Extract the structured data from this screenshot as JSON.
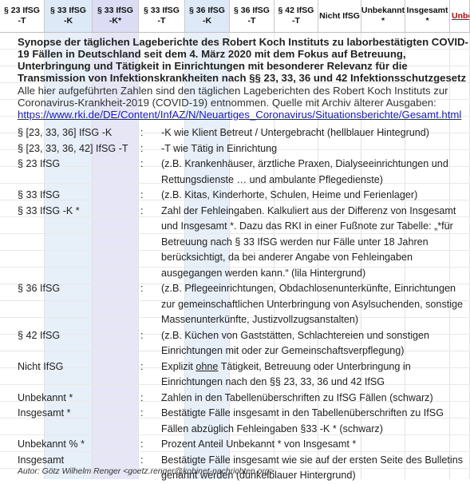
{
  "header": {
    "columns": [
      {
        "line1": "§ 23 IfSG",
        "line2": "-T",
        "bg": "#ffffff"
      },
      {
        "line1": "§ 33 IfSG",
        "line2": "-K",
        "bg": "#dde9f7"
      },
      {
        "line1": "§ 33 IfSG",
        "line2": "-K*",
        "bg": "#dcdcf4"
      },
      {
        "line1": "§ 33 IfSG",
        "line2": "-T",
        "bg": "#ffffff"
      },
      {
        "line1": "§ 36 IfSG",
        "line2": "-K",
        "bg": "#dde9f7"
      },
      {
        "line1": "§ 36 IfSG",
        "line2": "-T",
        "bg": "#ffffff"
      },
      {
        "line1": "§ 42 IfSG",
        "line2": "-T",
        "bg": "#ffffff"
      },
      {
        "line1": "Nicht IfSG",
        "line2": "",
        "bg": "#ffffff"
      },
      {
        "line1": "Unbekannt",
        "line2": "*",
        "bg": "#ffffff"
      },
      {
        "line1": "Insgesamt",
        "line2": "*",
        "bg": "#ffffff"
      },
      {
        "line1": "Unbeka",
        "line2": "",
        "bg": "#ffffff",
        "red": true
      }
    ]
  },
  "synopse": "Synopse der täglichen Lageberichte des Robert Koch Instituts zu laborbestätigten COVID-19 Fällen in Deutschland seit dem 4. März 2020 mit dem Fokus auf Betreuung, Unterbringung und Tätigkeit in Einrichtungen mit besonderer Relevanz für die Transmission von Infektionskrankheiten nach §§ 23, 33, 36 und 42 Infektionsschutzgesetz",
  "intro": "Alle hier aufgeführten Zahlen sind den täglichen Lageberichten des Robert Koch Instituts zur Coronavirus-Krankheit-2019 (COVID-19) entnommen. Quelle mit Archiv älterer Ausgaben:",
  "link": "https://www.rki.de/DE/Content/InfAZ/N/Neuartiges_Coronavirus/Situationsberichte/Gesamt.html",
  "legend": [
    {
      "key": "§ [23, 33, 36] IfSG -K",
      "colon": ":",
      "desc": "-K wie Klient Betreut / Untergebracht (hellblauer Hintegrund)"
    },
    {
      "key": "§ [23, 33, 36, 42] IfSG -T",
      "colon": ":",
      "desc": "-T wie Tätig in Einrichtung"
    },
    {
      "key": "§ 23 IfSG",
      "colon": ":",
      "desc": "(z.B. Krankenhäuser, ärztliche Praxen, Dialyseeinrichtungen und Rettungsdienste … und ambulante Pflegedienste)"
    },
    {
      "key": "§ 33 IfSG",
      "colon": ":",
      "desc": "(z.B. Kitas, Kinderhorte, Schulen, Heime und Ferienlager)"
    },
    {
      "key": "§ 33 IfSG -K *",
      "colon": ":",
      "desc": "Zahl der Fehleingaben. Kalkuliert aus der Differenz von Insgesamt und Insgesamt *. Dazu das RKI in einer Fußnote zur Tabelle: „*für Betreuung nach § 33 IfSG werden nur Fälle unter 18 Jahren berücksichtigt, da bei anderer Angabe von Fehleingaben ausgegangen werden kann.“ (lila Hintergrund)"
    },
    {
      "key": "§ 36 IfSG",
      "colon": ":",
      "desc": "(z.B. Pflegeeinrichtungen, Obdachlosenunterkünfte, Einrichtungen zur gemeinschaftlichen Unterbringung von     Asylsuchenden, sonstige Massenunterkünfte, Justizvollzugsanstalten)"
    },
    {
      "key": "§ 42 IfSG",
      "colon": ":",
      "desc": "(z.B. Küchen von Gaststätten, Schlachtereien und sonstigen Einrichtungen mit oder zur Gemeinschaftsverpflegung)"
    },
    {
      "key": "Nicht IfSG",
      "colon": ":",
      "desc_pre": "Explizit ",
      "desc_u": "ohne",
      "desc_post": " Tätigkeit, Betreuung oder Unterbringung in Einrichtungen nach den §§ 23, 33, 36 und 42 IfSG"
    },
    {
      "key": "Unbekannt *",
      "colon": ":",
      "desc": "Zahlen in den Tabellenüberschriften zu IfSG Fällen (schwarz)"
    },
    {
      "key": "Insgesamt *",
      "colon": ":",
      "desc": "Bestätigte Fälle insgesamt  in den Tabellenüberschriften zu IfSG Fällen abzüglich Fehleingaben §33 -K * (schwarz)"
    },
    {
      "key": "Unbekannt % *",
      "colon": ":",
      "desc": "Prozent Anteil Unbekannt * von Insgesamt *"
    },
    {
      "key": "Insgesamt",
      "colon": ":",
      "desc": "Bestätigte Fälle insgesamt wie sie auf der ersten Seite des Bulletins genannt werden (dunkelblauer Hintergrund)"
    }
  ],
  "author": "Autor: Götz Wilhelm Renger <goetz.renger@kobinet-nachrichten.org>"
}
